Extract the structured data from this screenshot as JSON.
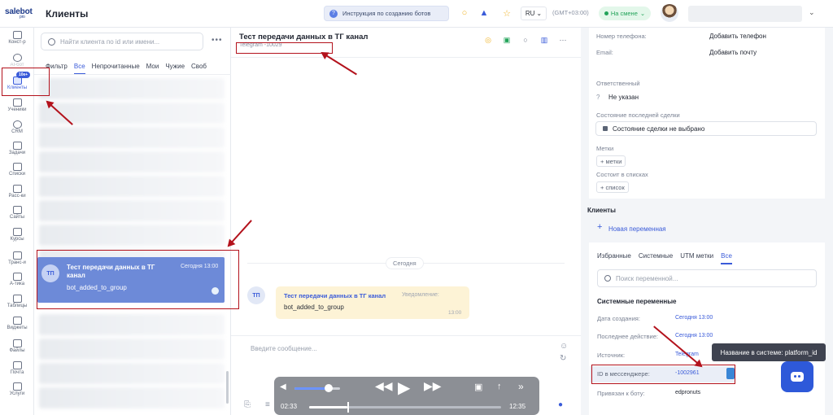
{
  "topbar": {
    "logo": "salebot",
    "logo_sub": "pro",
    "page_title": "Клиенты",
    "guide_button": "Инструкция по созданию ботов",
    "language": "RU",
    "timezone": "(GMT+03:00)",
    "status": "На смене",
    "icons": [
      "lightbulb-icon",
      "bell-icon",
      "star-icon"
    ]
  },
  "nav": {
    "new_badge": "10к+",
    "items": [
      {
        "label": "Конст-р",
        "icon": "constructor-icon"
      },
      {
        "label": "AI-бот",
        "icon": "ai-icon"
      },
      {
        "label": "Клиенты",
        "icon": "clients-icon",
        "active": true
      },
      {
        "label": "Ученики",
        "icon": "students-icon"
      },
      {
        "label": "CRM",
        "icon": "crm-icon"
      },
      {
        "label": "Задачи",
        "icon": "tasks-icon"
      },
      {
        "label": "Списки",
        "icon": "lists-icon"
      },
      {
        "label": "Расс-ки",
        "icon": "mailing-icon"
      },
      {
        "label": "Сайты",
        "icon": "sites-icon"
      },
      {
        "label": "Курсы",
        "icon": "courses-icon"
      },
      {
        "label": "Транс-и",
        "icon": "broadcast-icon"
      },
      {
        "label": "А-тика",
        "icon": "analytics-icon"
      },
      {
        "label": "Таблицы",
        "icon": "tables-icon"
      },
      {
        "label": "Виджеты",
        "icon": "widgets-icon"
      },
      {
        "label": "Файлы",
        "icon": "files-icon"
      },
      {
        "label": "Почта",
        "icon": "mail-icon"
      },
      {
        "label": "Услуги",
        "icon": "services-icon"
      }
    ]
  },
  "clients": {
    "search_placeholder": "Найти клиента по id или имени...",
    "filters": [
      "Фильтр",
      "Все",
      "Непрочитанные",
      "Мои",
      "Чужие",
      "Своб"
    ],
    "selected_chat": {
      "initials": "ТП",
      "name": "Тест передачи данных в ТГ канал",
      "time": "Сегодня 13:00",
      "message": "bot_added_to_group"
    }
  },
  "chat": {
    "title": "Тест передачи данных в ТГ канал",
    "subtitle": "Telegram -10029",
    "day": "Сегодня",
    "message": {
      "initials": "ТП",
      "author": "Тест передачи данных в ТГ канал",
      "kind": "Уведомление:",
      "text": "bot_added_to_group",
      "time": "13:00"
    },
    "composer_placeholder": "Введите сообщение..."
  },
  "player": {
    "current": "02:33",
    "total": "12:35",
    "volume": 0.75,
    "progress": 0.2
  },
  "right": {
    "phone_label": "Номер телефона:",
    "phone_action": "Добавить телефон",
    "email_label": "Email:",
    "email_action": "Добавить почту",
    "responsible_label": "Ответственный",
    "responsible_value": "Не указан",
    "deal_label": "Состояние последней сделки",
    "deal_value": "Состояние сделки не выбрано",
    "tags_label": "Метки",
    "tags_chip": "+ метки",
    "lists_label": "Состоит в списках",
    "lists_chip": "+ список",
    "clients_title": "Клиенты",
    "new_variable": "Новая переменная",
    "tabs": [
      "Избранные",
      "Системные",
      "UTM метки",
      "Все"
    ],
    "var_search_placeholder": "Поиск переменной...",
    "system_vars_title": "Системные переменные",
    "rows": [
      {
        "label": "Дата создания:",
        "value": "Сегодня 13:00"
      },
      {
        "label": "Последнее действие:",
        "value": "Сегодня 13:00"
      },
      {
        "label": "Источник:",
        "value": "Telegram"
      },
      {
        "label": "ID в мессенджере:",
        "value": "-1002961"
      },
      {
        "label": "Привязан к боту:",
        "value": "edpronuts"
      }
    ],
    "tooltip": "Название в системе: platform_id"
  }
}
